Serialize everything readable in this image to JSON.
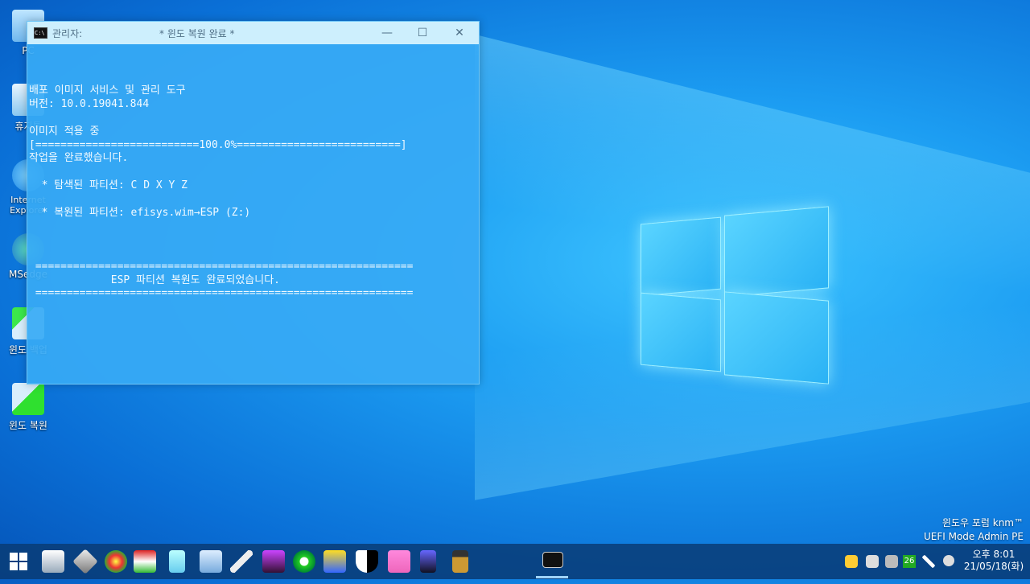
{
  "desktop": {
    "icons": [
      {
        "label": "PC"
      },
      {
        "label": "휴지통"
      },
      {
        "label": "Internet Explorer"
      },
      {
        "label": "MSedge"
      },
      {
        "label": "윈도 백업"
      },
      {
        "label": "윈도 복원"
      }
    ]
  },
  "window": {
    "title_left": "관리자:",
    "title_center": "* 윈도 복원 완료 *",
    "icon": "cmd-icon",
    "controls": {
      "minimize": "—",
      "maximize": "☐",
      "close": "✕"
    }
  },
  "console": {
    "lines": [
      "",
      "",
      "",
      "배포 이미지 서비스 및 관리 도구",
      "버전: 10.0.19041.844",
      "",
      "이미지 적용 중",
      "[==========================100.0%==========================]",
      "작업을 완료했습니다.",
      "",
      "  * 탐색된 파티션: C D X Y Z",
      "",
      "  * 복원된 파티션: efisys.wim→ESP (Z:)",
      "",
      "",
      "",
      " ============================================================",
      "             ESP 파티션 복원도 완료되었습니다.",
      " ============================================================"
    ]
  },
  "taskbar": {
    "start": "windows-start-icon",
    "apps": [
      "monitor-icon",
      "tools-icon",
      "disk-icon",
      "drive-icon",
      "folder-icon",
      "network-icon",
      "wrench-icon",
      "media-icon",
      "sync-icon",
      "device-icon",
      "shield-icon",
      "store-icon",
      "phone-icon",
      "card-icon"
    ],
    "active_app": "cmd-icon",
    "tray": {
      "badge": "26",
      "time": "오후 8:01",
      "date": "21/05/18(화)"
    }
  },
  "watermark": {
    "line1": "윈도우 포럼 knm™",
    "line2": "UEFI Mode Admin PE"
  }
}
